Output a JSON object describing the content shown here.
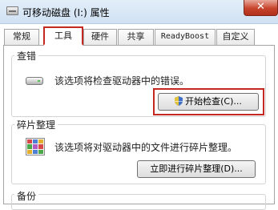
{
  "window": {
    "title": "可移动磁盘 (I:) 属性",
    "close_symbol": "✕"
  },
  "tabs": [
    {
      "label": "常规"
    },
    {
      "label": "工具",
      "selected": true
    },
    {
      "label": "硬件"
    },
    {
      "label": "共享"
    },
    {
      "label": "ReadyBoost"
    },
    {
      "label": "自定义"
    }
  ],
  "error_checking": {
    "title": "查错",
    "description": "该选项将检查驱动器中的错误。",
    "button_label": "开始检查(C)..."
  },
  "defrag": {
    "title": "碎片整理",
    "description": "该选项将对驱动器中的文件进行碎片整理。",
    "button_label": "立即进行碎片整理(D)..."
  },
  "backup": {
    "title": "备份"
  },
  "colors": {
    "highlight": "#c4281f",
    "title_bar": "#d7e6f5",
    "close_button": "#c7432c"
  }
}
